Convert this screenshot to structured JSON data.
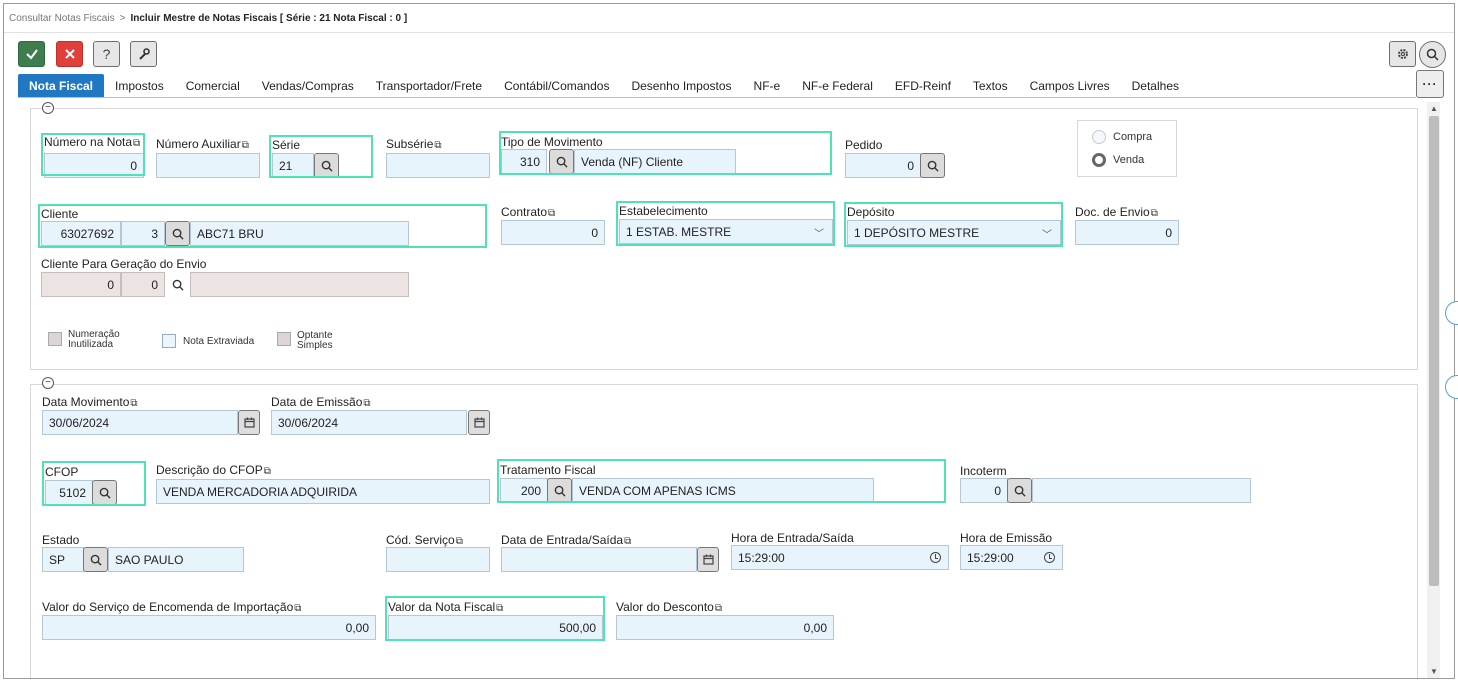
{
  "breadcrumb": {
    "parent": "Consultar Notas Fiscais",
    "separator": ">",
    "current": "Incluir Mestre de Notas Fiscais [ Série : 21 Nota Fiscal : 0 ]"
  },
  "toolbar": {
    "help_label": "?"
  },
  "tabs": [
    "Nota Fiscal",
    "Impostos",
    "Comercial",
    "Vendas/Compras",
    "Transportador/Frete",
    "Contábil/Comandos",
    "Desenho Impostos",
    "NF-e",
    "NF-e Federal",
    "EFD-Reinf",
    "Textos",
    "Campos Livres",
    "Detalhes"
  ],
  "tab_more": "···",
  "sec1": {
    "collapse": "−",
    "numero_nota": {
      "label": "Número na Nota",
      "value": "0"
    },
    "numero_auxiliar": {
      "label": "Número Auxiliar",
      "value": ""
    },
    "serie": {
      "label": "Série",
      "value": "21"
    },
    "subserie": {
      "label": "Subsérie",
      "value": ""
    },
    "tipo_movimento": {
      "label": "Tipo de Movimento",
      "code": "310",
      "desc": "Venda (NF) Cliente"
    },
    "pedido": {
      "label": "Pedido",
      "value": "0"
    },
    "compra_label": "Compra",
    "venda_label": "Venda",
    "cliente": {
      "label": "Cliente",
      "code": "63027692",
      "seq": "3",
      "name": "ABC71 BRU"
    },
    "contrato": {
      "label": "Contrato",
      "value": "0"
    },
    "estabelecimento": {
      "label": "Estabelecimento",
      "value": "1 ESTAB. MESTRE"
    },
    "deposito": {
      "label": "Depósito",
      "value": "1 DEPÓSITO MESTRE"
    },
    "doc_envio": {
      "label": "Doc. de Envio",
      "value": "0"
    },
    "cliente_envio": {
      "label": "Cliente Para Geração do Envio",
      "code": "0",
      "seq": "0",
      "name": ""
    },
    "chk_numeracao": [
      "Numeração",
      "Inutilizada"
    ],
    "chk_extraviada": "Nota Extraviada",
    "chk_optante": [
      "Optante",
      "Simples"
    ]
  },
  "sec2": {
    "collapse": "−",
    "data_movimento": {
      "label": "Data Movimento",
      "value": "30/06/2024"
    },
    "data_emissao": {
      "label": "Data de Emissão",
      "value": "30/06/2024"
    },
    "cfop": {
      "label": "CFOP",
      "value": "5102"
    },
    "desc_cfop": {
      "label": "Descrição do CFOP",
      "value": "VENDA MERCADORIA ADQUIRIDA"
    },
    "tratamento": {
      "label": "Tratamento Fiscal",
      "code": "200",
      "desc": "VENDA COM APENAS ICMS"
    },
    "incoterm": {
      "label": "Incoterm",
      "value": "0",
      "desc": ""
    },
    "estado": {
      "label": "Estado",
      "code": "SP",
      "name": "SAO PAULO"
    },
    "cod_servico": {
      "label": "Cód. Serviço",
      "value": ""
    },
    "data_entrada": {
      "label": "Data de Entrada/Saída",
      "value": ""
    },
    "hora_entrada": {
      "label": "Hora de Entrada/Saída",
      "value": "15:29:00"
    },
    "hora_emissao": {
      "label": "Hora de Emissão",
      "value": "15:29:00"
    },
    "valor_servico": {
      "label": "Valor do Serviço de Encomenda de Importação",
      "value": "0,00"
    },
    "valor_nota": {
      "label": "Valor da Nota Fiscal",
      "value": "500,00"
    },
    "valor_desconto": {
      "label": "Valor do Desconto",
      "value": "0,00"
    }
  },
  "colors": {
    "accent": "#1f78c1",
    "highlight": "#4ee2b5",
    "field_bg": "#e8f4fc"
  },
  "icons": [
    "check-icon",
    "close-icon",
    "help-icon",
    "wrench-icon",
    "gear-icon",
    "search-icon",
    "copy-icon",
    "calendar-icon",
    "clock-icon",
    "chevron-down-icon"
  ]
}
